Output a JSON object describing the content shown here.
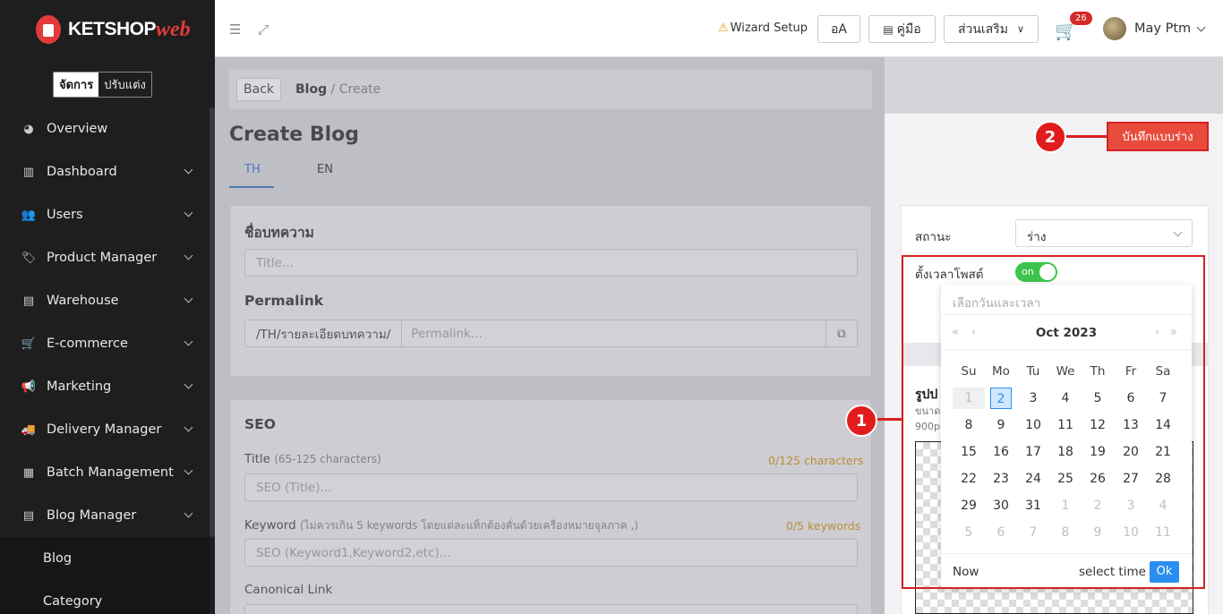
{
  "app": {
    "logo_text": "KETSHOP",
    "logo_web": "web"
  },
  "mode_toggle": {
    "active": "จัดการ",
    "inactive": "ปรับแต่ง"
  },
  "sidebar": {
    "items": [
      {
        "label": "Overview",
        "icon": "pie-chart-icon",
        "has_chevron": false
      },
      {
        "label": "Dashboard",
        "icon": "bar-chart-icon",
        "has_chevron": true
      },
      {
        "label": "Users",
        "icon": "users-icon",
        "has_chevron": true
      },
      {
        "label": "Product Manager",
        "icon": "tag-icon",
        "has_chevron": true
      },
      {
        "label": "Warehouse",
        "icon": "warehouse-icon",
        "has_chevron": true
      },
      {
        "label": "E-commerce",
        "icon": "cart-icon",
        "has_chevron": true
      },
      {
        "label": "Marketing",
        "icon": "megaphone-icon",
        "has_chevron": true
      },
      {
        "label": "Delivery Manager",
        "icon": "truck-icon",
        "has_chevron": true
      },
      {
        "label": "Batch Management",
        "icon": "boxes-icon",
        "has_chevron": true
      },
      {
        "label": "Blog Manager",
        "icon": "newspaper-icon",
        "has_chevron": true
      }
    ],
    "subitems": [
      {
        "label": "Blog"
      },
      {
        "label": "Category"
      }
    ]
  },
  "header": {
    "wizard": "Wizard Setup",
    "lang_button": "อA",
    "manual_button": "คู่มือ",
    "addons_button": "ส่วนเสริม",
    "cart_badge": "26",
    "user_name": "May Ptm"
  },
  "breadcrumb": {
    "back": "Back",
    "current": "Blog",
    "sep": " / ",
    "page": "Create"
  },
  "page": {
    "title": "Create Blog",
    "tabs": [
      "TH",
      "EN"
    ],
    "article_name_label": "ชื่อบทความ",
    "title_placeholder": "Title...",
    "permalink_label": "Permalink",
    "permalink_prefix": "/TH/รายละเอียดบทความ/",
    "permalink_placeholder": "Permalink...",
    "seo": {
      "heading": "SEO",
      "title_label": "Title",
      "title_hint": "(65-125 characters)",
      "title_counter": "0/125 characters",
      "title_placeholder": "SEO (Title)...",
      "keyword_label": "Keyword",
      "keyword_hint": "(ไม่ควรเกิน 5 keywords โดยแต่ละแท็กต้องคั่นด้วยเครื่องหมายจุลภาค ,)",
      "keyword_counter": "0/5 keywords",
      "keyword_placeholder": "SEO (Keyword1,Keyword2,etc)...",
      "canonical_label": "Canonical Link"
    }
  },
  "right_panel": {
    "save_draft": "บันทึกแบบร่าง",
    "status_label": "สถานะ",
    "status_value": "ร่าง",
    "schedule_label": "ตั้งเวลาโพสต์",
    "toggle_label": "on",
    "image_title": "รูปป",
    "image_hint_1": "ขนาด",
    "image_hint_2": "900p"
  },
  "datepicker": {
    "placeholder": "เลือกวันและเวลา",
    "month": "Oct 2023",
    "weekdays": [
      "Su",
      "Mo",
      "Tu",
      "We",
      "Th",
      "Fr",
      "Sa"
    ],
    "weeks": [
      [
        "1",
        "2",
        "3",
        "4",
        "5",
        "6",
        "7"
      ],
      [
        "8",
        "9",
        "10",
        "11",
        "12",
        "13",
        "14"
      ],
      [
        "15",
        "16",
        "17",
        "18",
        "19",
        "20",
        "21"
      ],
      [
        "22",
        "23",
        "24",
        "25",
        "26",
        "27",
        "28"
      ],
      [
        "29",
        "30",
        "31",
        "1",
        "2",
        "3",
        "4"
      ],
      [
        "5",
        "6",
        "7",
        "8",
        "9",
        "10",
        "11"
      ]
    ],
    "selected_day": "2",
    "now": "Now",
    "select_time": "select time",
    "ok": "Ok"
  },
  "annotations": {
    "one": "1",
    "two": "2"
  },
  "colors": {
    "accent": "#e84b3c",
    "primary": "#2b6bcb",
    "toggle_on": "#3cc44c",
    "annotation": "#d62020"
  }
}
